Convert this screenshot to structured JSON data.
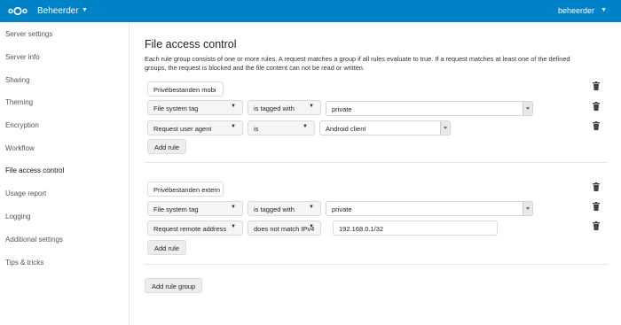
{
  "header": {
    "app_name": "Beheerder",
    "user_name": "beheerder",
    "brand_color": "#0082c9"
  },
  "sidebar": {
    "items": [
      {
        "label": "Server settings"
      },
      {
        "label": "Server info"
      },
      {
        "label": "Sharing"
      },
      {
        "label": "Theming"
      },
      {
        "label": "Encryption"
      },
      {
        "label": "Workflow"
      },
      {
        "label": "File access control",
        "active": true
      },
      {
        "label": "Usage report"
      },
      {
        "label": "Logging"
      },
      {
        "label": "Additional settings"
      },
      {
        "label": "Tips & tricks"
      }
    ]
  },
  "main": {
    "title": "File access control",
    "description": "Each rule group consists of one or more rules. A request matches a group if all rules evaluate to true. If a request matches at least one of the defined groups, the request is blocked and the file content can not be read or written.",
    "groups": [
      {
        "name": "Privébestanden mobi",
        "rules": [
          {
            "check": "File system tag",
            "operator": "is tagged with",
            "value": "private"
          },
          {
            "check": "Request user agent",
            "operator": "is",
            "value": "Android client"
          }
        ],
        "add_rule_label": "Add rule"
      },
      {
        "name": "Privébestanden extern",
        "rules": [
          {
            "check": "File system tag",
            "operator": "is tagged with",
            "value": "private"
          },
          {
            "check": "Request remote address",
            "operator": "does not match IPv4",
            "value": "192.168.0.1/32"
          }
        ],
        "add_rule_label": "Add rule"
      }
    ],
    "add_group_label": "Add rule group"
  }
}
